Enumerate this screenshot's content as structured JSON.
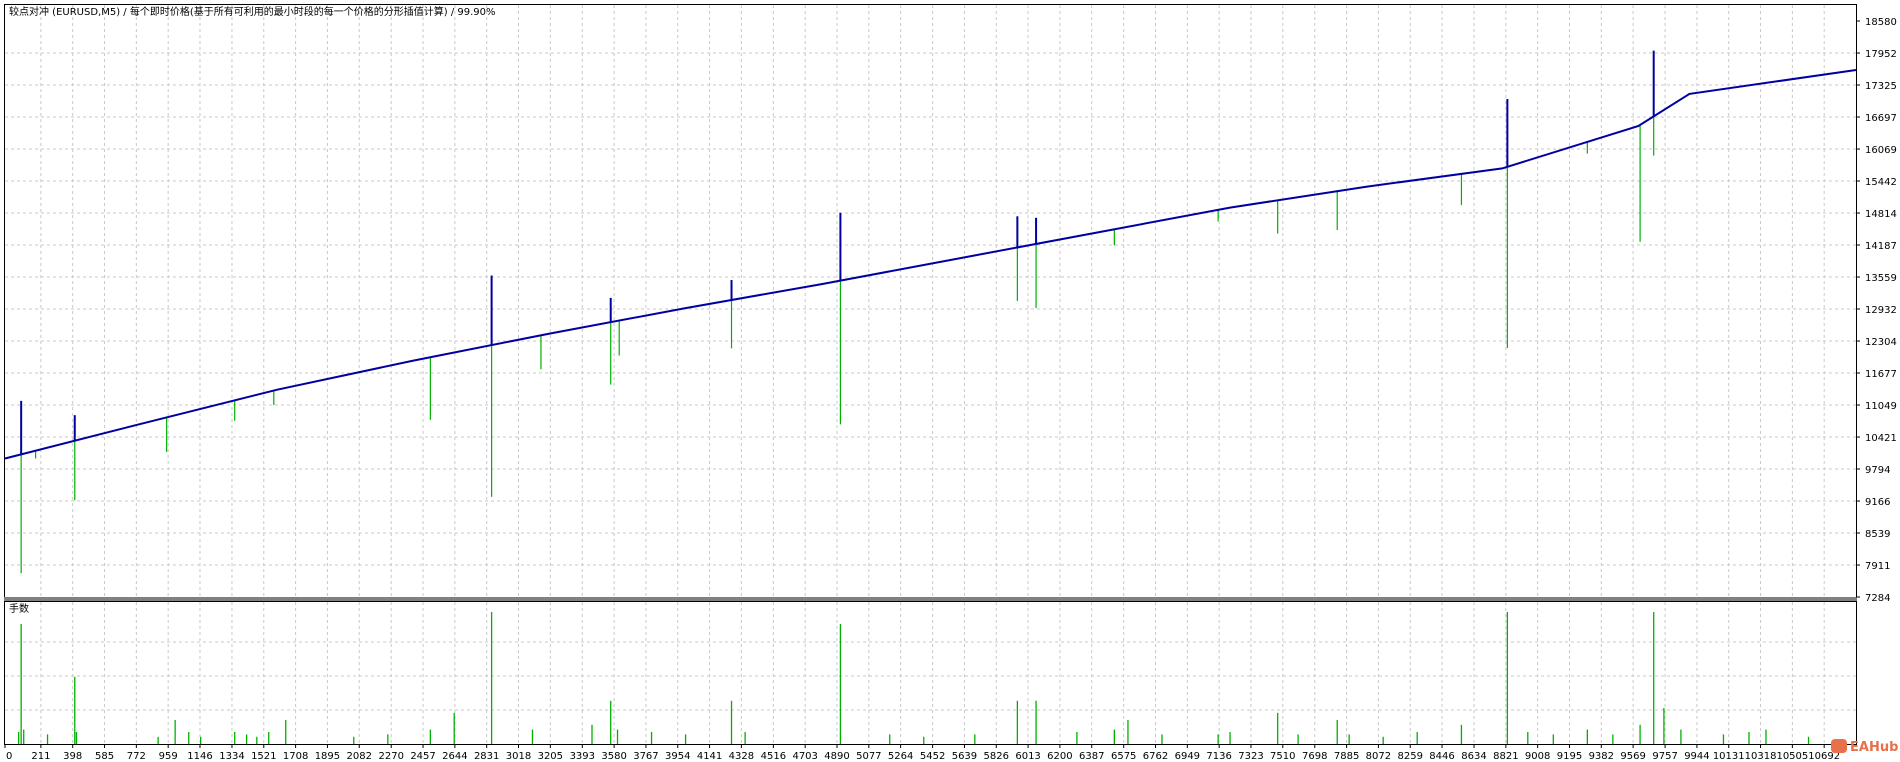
{
  "header": {
    "title_prefix": "较点对冲 (EURUSD,M5)",
    "title_desc": "每个即时价格(基于所有可利用的最小时段的每一个价格的分形插值计算)",
    "title_quality": "99.90%"
  },
  "subpanel": {
    "label": "手数"
  },
  "watermark": {
    "text": "EAHub"
  },
  "colors": {
    "balance": "#0000a0",
    "equity": "#00b000",
    "lots": "#00b000",
    "grid": "#c8c8c8",
    "divider": "#808080",
    "watermark": "#e8704a"
  },
  "chart_data": [
    {
      "type": "line",
      "title": "较点对冲 (EURUSD,M5) / 每个即时价格(基于所有可利用的最小时段的每一个价格的分形插值计算) / 99.90%",
      "ylim": [
        7284,
        18580
      ],
      "y_ticks": [
        "18580",
        "17952",
        "17325",
        "16697",
        "16069",
        "15442",
        "14814",
        "14187",
        "13559",
        "12932",
        "12304",
        "11677",
        "11049",
        "10421",
        "9794",
        "9166",
        "8539",
        "7911",
        "7284"
      ],
      "xlim": [
        0,
        10879
      ],
      "x_ticks": [
        "0",
        "211",
        "398",
        "585",
        "772",
        "959",
        "1146",
        "1334",
        "1521",
        "1708",
        "1895",
        "2082",
        "2270",
        "2457",
        "2644",
        "2831",
        "3018",
        "3205",
        "3393",
        "3580",
        "3767",
        "3954",
        "4141",
        "4328",
        "4516",
        "4703",
        "4890",
        "5077",
        "5264",
        "5452",
        "5639",
        "5826",
        "6013",
        "6200",
        "6387",
        "6575",
        "6762",
        "6949",
        "7136",
        "7323",
        "7510",
        "7698",
        "7885",
        "8072",
        "8259",
        "8446",
        "8634",
        "8821",
        "9008",
        "9195",
        "9382",
        "9569",
        "9757",
        "9944",
        "10131",
        "10318",
        "10505",
        "10692"
      ],
      "grid": true,
      "series": [
        {
          "role": "balance",
          "x": [
            0,
            800,
            1600,
            2400,
            3200,
            4000,
            4800,
            5600,
            6400,
            7200,
            8000,
            8800,
            9600,
            9900,
            10879
          ],
          "values": [
            10000,
            10680,
            11350,
            11920,
            12450,
            12950,
            13420,
            13920,
            14420,
            14920,
            15330,
            15690,
            16520,
            17150,
            17620
          ]
        },
        {
          "role": "equity_dips",
          "x": [
            95,
            180,
            410,
            950,
            1350,
            1580,
            2500,
            2860,
            3150,
            3560,
            3610,
            4270,
            4910,
            5950,
            6060,
            6520,
            7130,
            7480,
            7830,
            8560,
            8830,
            9300,
            9610,
            9690
          ],
          "values": [
            7750,
            10000,
            9180,
            10130,
            10740,
            11050,
            10760,
            9250,
            11750,
            11450,
            12020,
            12160,
            10670,
            13090,
            12950,
            14180,
            14650,
            14410,
            14480,
            14970,
            12170,
            15980,
            14250,
            15940
          ]
        },
        {
          "role": "balance_spikes",
          "x": [
            95,
            410,
            2860,
            3560,
            4270,
            4910,
            5950,
            6060,
            8830,
            9690
          ],
          "values": [
            11130,
            10850,
            13590,
            13150,
            13500,
            14820,
            14750,
            14720,
            17050,
            18000
          ]
        }
      ]
    },
    {
      "type": "bar",
      "title": "手数",
      "x": [
        80,
        95,
        110,
        250,
        410,
        420,
        900,
        1000,
        1080,
        1150,
        1350,
        1420,
        1480,
        1550,
        1650,
        2050,
        2250,
        2500,
        2640,
        2860,
        3100,
        3450,
        3560,
        3600,
        3800,
        4000,
        4270,
        4350,
        4910,
        5200,
        5400,
        5700,
        5950,
        6060,
        6300,
        6520,
        6600,
        6800,
        7130,
        7200,
        7480,
        7600,
        7830,
        7900,
        8100,
        8300,
        8560,
        8830,
        8950,
        9100,
        9300,
        9450,
        9610,
        9690,
        9750,
        9850,
        10100,
        10250,
        10350,
        10600
      ],
      "values": [
        0.1,
        1.0,
        0.12,
        0.08,
        0.56,
        0.1,
        0.06,
        0.2,
        0.1,
        0.06,
        0.1,
        0.08,
        0.06,
        0.1,
        0.2,
        0.06,
        0.08,
        0.12,
        0.26,
        1.1,
        0.12,
        0.16,
        0.36,
        0.12,
        0.1,
        0.08,
        0.36,
        0.1,
        1.0,
        0.08,
        0.06,
        0.08,
        0.36,
        0.36,
        0.1,
        0.12,
        0.2,
        0.08,
        0.08,
        0.1,
        0.26,
        0.08,
        0.2,
        0.08,
        0.06,
        0.1,
        0.16,
        1.1,
        0.1,
        0.08,
        0.12,
        0.08,
        0.16,
        1.1,
        0.3,
        0.12,
        0.08,
        0.1,
        0.12,
        0.06
      ]
    }
  ]
}
